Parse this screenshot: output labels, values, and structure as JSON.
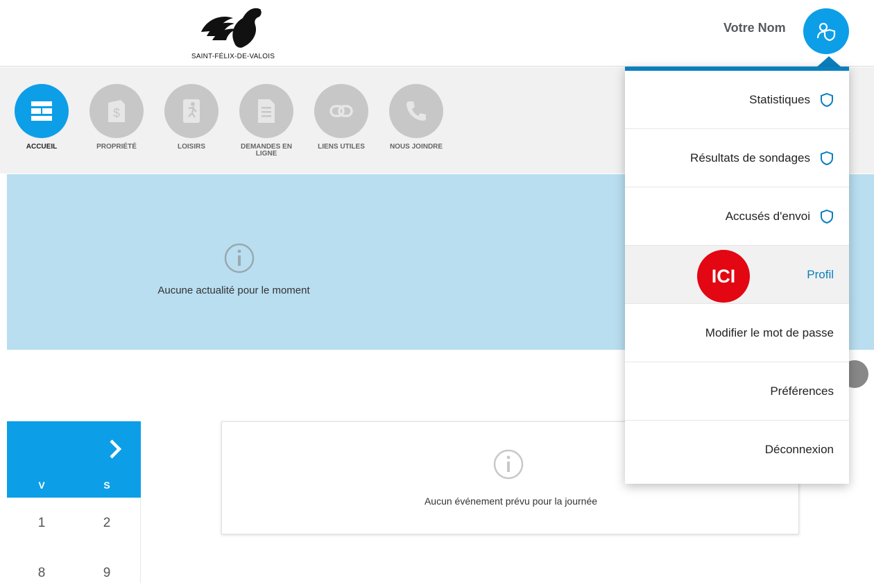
{
  "header": {
    "logo_text": "SAINT-FÉLIX-DE-VALOIS",
    "user_name": "Votre Nom"
  },
  "nav": {
    "items": [
      {
        "label": "ACCUEIL",
        "icon": "grid-icon",
        "active": true
      },
      {
        "label": "PROPRIÉTÉ",
        "icon": "dollar-document-icon",
        "active": false
      },
      {
        "label": "LOISIRS",
        "icon": "runner-icon",
        "active": false
      },
      {
        "label": "DEMANDES EN LIGNE",
        "icon": "document-icon",
        "active": false
      },
      {
        "label": "LIENS UTILES",
        "icon": "link-icon",
        "active": false
      },
      {
        "label": "NOUS JOINDRE",
        "icon": "phone-icon",
        "active": false
      }
    ]
  },
  "news": {
    "empty_message": "Aucune actualité pour le moment",
    "icon": "info-icon"
  },
  "calendar": {
    "day_names": [
      "V",
      "S"
    ],
    "weeks": [
      [
        "1",
        "2"
      ],
      [
        "8",
        "9"
      ]
    ],
    "next_icon": "chevron-right-icon"
  },
  "events": {
    "empty_message": "Aucun événement prévu pour la journée",
    "icon": "info-icon"
  },
  "dropdown": {
    "items": [
      {
        "label": "Statistiques",
        "icon": "shield-icon"
      },
      {
        "label": "Résultats de sondages",
        "icon": "shield-icon"
      },
      {
        "label": "Accusés d'envoi",
        "icon": "shield-icon"
      },
      {
        "label": "Profil",
        "badge": "ICI"
      },
      {
        "label": "Modifier le mot de passe"
      },
      {
        "label": "Préférences"
      },
      {
        "label": "Déconnexion"
      }
    ]
  },
  "colors": {
    "accent": "#0d9ee8",
    "dropdown_border": "#0a7fbf",
    "news_background": "#b9def0",
    "badge": "#e30613"
  }
}
